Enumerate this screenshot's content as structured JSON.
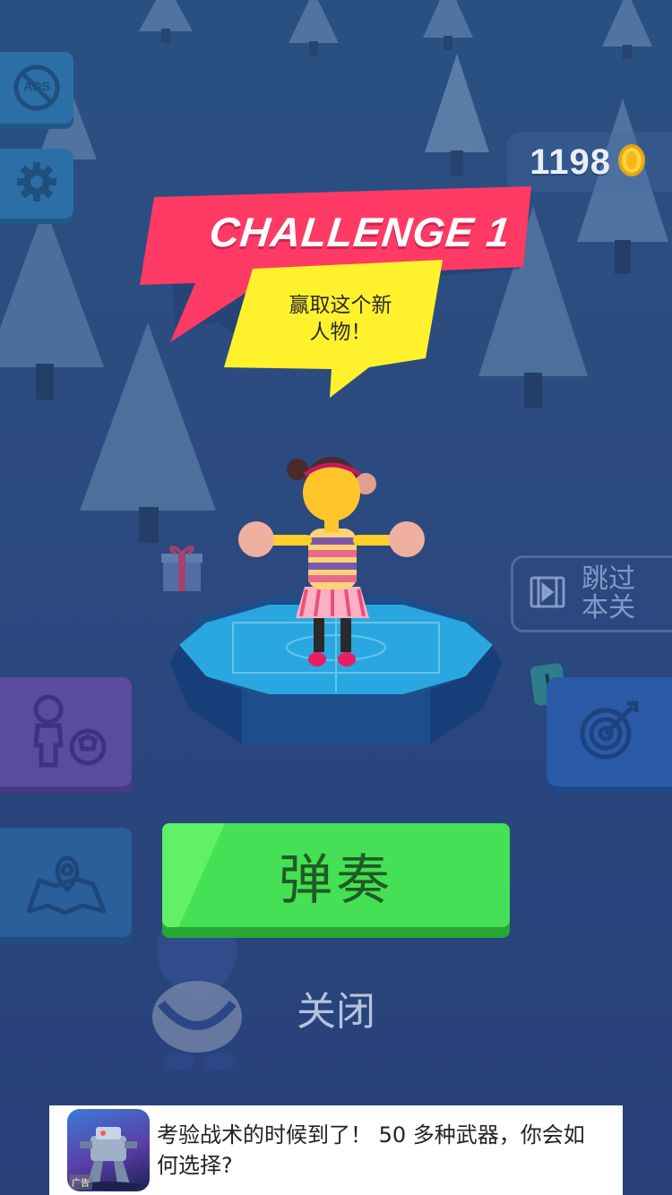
{
  "hud": {
    "coins": "1198",
    "noads_label": "ADS",
    "skip_label": "跳过本关",
    "alert_mark": "!"
  },
  "challenge": {
    "title": "CHALLENGE 1",
    "subtitle": "赢取这个新人物！"
  },
  "actions": {
    "play_label": "弹奏",
    "close_label": "关闭"
  },
  "ad": {
    "text": "考验战术的时候到了！ 50 多种武器，你会如何选择?",
    "tag": "广告"
  },
  "colors": {
    "background": "#2f5a8d",
    "banner_red": "#ff3a64",
    "banner_yellow": "#fff22d",
    "play_green": "#45e055",
    "platform_blue": "#2aa7e0"
  },
  "icons": {
    "noads": "no-ads-icon",
    "settings": "gear-icon",
    "coin": "coin-icon",
    "skip": "film-skip-icon",
    "character": "character-ball-icon",
    "map": "map-pin-icon",
    "target": "target-icon"
  }
}
